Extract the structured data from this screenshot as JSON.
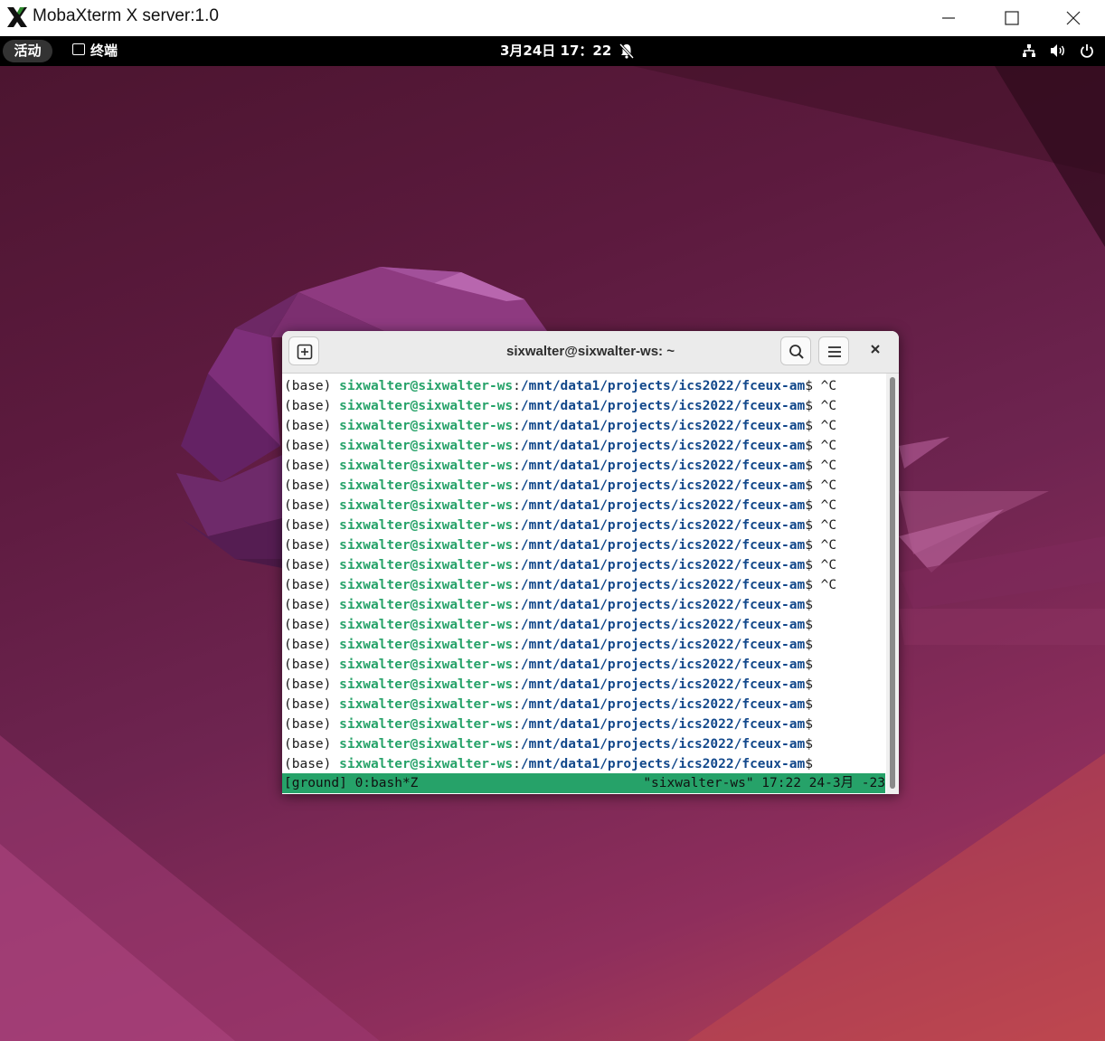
{
  "host_window": {
    "title": "MobaXterm X server:1.0",
    "logo_icon": "mobaxterm-x-logo",
    "controls": [
      "minimize-icon",
      "maximize-icon",
      "close-icon"
    ]
  },
  "top_bar": {
    "activities": "活动",
    "app_name": "终端",
    "clock": "3月24日 17：22",
    "tray_icons": [
      "network-icon",
      "volume-icon",
      "power-icon"
    ],
    "notification_icon": "bell-muted-icon"
  },
  "terminal": {
    "title": "sixwalter@sixwalter-ws: ~",
    "header_buttons": [
      "new-tab-icon",
      "search-icon",
      "hamburger-menu-icon",
      "close-icon"
    ],
    "lines": [
      {
        "prefix": "(base) ",
        "user": "sixwalter@sixwalter-ws",
        "sep": ":",
        "path": "/mnt/data1/projects/ics2022/fceux-am",
        "suffix": "$ ^C"
      },
      {
        "prefix": "(base) ",
        "user": "sixwalter@sixwalter-ws",
        "sep": ":",
        "path": "/mnt/data1/projects/ics2022/fceux-am",
        "suffix": "$ ^C"
      },
      {
        "prefix": "(base) ",
        "user": "sixwalter@sixwalter-ws",
        "sep": ":",
        "path": "/mnt/data1/projects/ics2022/fceux-am",
        "suffix": "$ ^C"
      },
      {
        "prefix": "(base) ",
        "user": "sixwalter@sixwalter-ws",
        "sep": ":",
        "path": "/mnt/data1/projects/ics2022/fceux-am",
        "suffix": "$ ^C"
      },
      {
        "prefix": "(base) ",
        "user": "sixwalter@sixwalter-ws",
        "sep": ":",
        "path": "/mnt/data1/projects/ics2022/fceux-am",
        "suffix": "$ ^C"
      },
      {
        "prefix": "(base) ",
        "user": "sixwalter@sixwalter-ws",
        "sep": ":",
        "path": "/mnt/data1/projects/ics2022/fceux-am",
        "suffix": "$ ^C"
      },
      {
        "prefix": "(base) ",
        "user": "sixwalter@sixwalter-ws",
        "sep": ":",
        "path": "/mnt/data1/projects/ics2022/fceux-am",
        "suffix": "$ ^C"
      },
      {
        "prefix": "(base) ",
        "user": "sixwalter@sixwalter-ws",
        "sep": ":",
        "path": "/mnt/data1/projects/ics2022/fceux-am",
        "suffix": "$ ^C"
      },
      {
        "prefix": "(base) ",
        "user": "sixwalter@sixwalter-ws",
        "sep": ":",
        "path": "/mnt/data1/projects/ics2022/fceux-am",
        "suffix": "$ ^C"
      },
      {
        "prefix": "(base) ",
        "user": "sixwalter@sixwalter-ws",
        "sep": ":",
        "path": "/mnt/data1/projects/ics2022/fceux-am",
        "suffix": "$ ^C"
      },
      {
        "prefix": "(base) ",
        "user": "sixwalter@sixwalter-ws",
        "sep": ":",
        "path": "/mnt/data1/projects/ics2022/fceux-am",
        "suffix": "$ ^C"
      },
      {
        "prefix": "(base) ",
        "user": "sixwalter@sixwalter-ws",
        "sep": ":",
        "path": "/mnt/data1/projects/ics2022/fceux-am",
        "suffix": "$"
      },
      {
        "prefix": "(base) ",
        "user": "sixwalter@sixwalter-ws",
        "sep": ":",
        "path": "/mnt/data1/projects/ics2022/fceux-am",
        "suffix": "$"
      },
      {
        "prefix": "(base) ",
        "user": "sixwalter@sixwalter-ws",
        "sep": ":",
        "path": "/mnt/data1/projects/ics2022/fceux-am",
        "suffix": "$"
      },
      {
        "prefix": "(base) ",
        "user": "sixwalter@sixwalter-ws",
        "sep": ":",
        "path": "/mnt/data1/projects/ics2022/fceux-am",
        "suffix": "$"
      },
      {
        "prefix": "(base) ",
        "user": "sixwalter@sixwalter-ws",
        "sep": ":",
        "path": "/mnt/data1/projects/ics2022/fceux-am",
        "suffix": "$"
      },
      {
        "prefix": "(base) ",
        "user": "sixwalter@sixwalter-ws",
        "sep": ":",
        "path": "/mnt/data1/projects/ics2022/fceux-am",
        "suffix": "$"
      },
      {
        "prefix": "(base) ",
        "user": "sixwalter@sixwalter-ws",
        "sep": ":",
        "path": "/mnt/data1/projects/ics2022/fceux-am",
        "suffix": "$"
      },
      {
        "prefix": "(base) ",
        "user": "sixwalter@sixwalter-ws",
        "sep": ":",
        "path": "/mnt/data1/projects/ics2022/fceux-am",
        "suffix": "$"
      },
      {
        "prefix": "(base) ",
        "user": "sixwalter@sixwalter-ws",
        "sep": ":",
        "path": "/mnt/data1/projects/ics2022/fceux-am",
        "suffix": "$"
      }
    ],
    "tmux_status_left": "[ground] 0:bash*Z",
    "tmux_status_right": "\"sixwalter-ws\" 17:22 24-3月 -23"
  },
  "colors": {
    "prompt_user": "#26a269",
    "prompt_path": "#12488b",
    "tmux_bar": "#26a269",
    "top_bar": "#000000"
  }
}
